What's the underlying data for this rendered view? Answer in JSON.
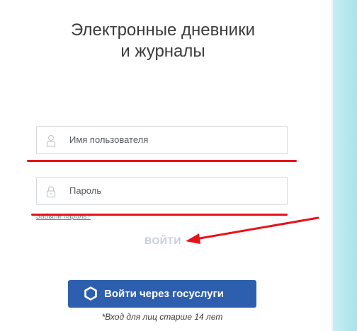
{
  "header": {
    "title_line1": "Электронные дневники",
    "title_line2": "и журналы"
  },
  "form": {
    "username_placeholder": "Имя пользователя",
    "password_placeholder": "Пароль",
    "forgot_password_label": "Забыли пароль?",
    "login_label": "ВОЙТИ"
  },
  "gosuslugi": {
    "button_label": "Войти через госуслуги",
    "age_note": "*Вход для лиц старше 14 лет"
  },
  "icons": {
    "username": "user-icon",
    "password": "lock-icon",
    "gosuslugi": "hexagon-icon"
  },
  "colors": {
    "annotation_red": "#e8121a",
    "gosuslugi_blue": "#2e5fae",
    "login_disabled": "#c6cde0",
    "side_panel": "#b4e7ee"
  }
}
